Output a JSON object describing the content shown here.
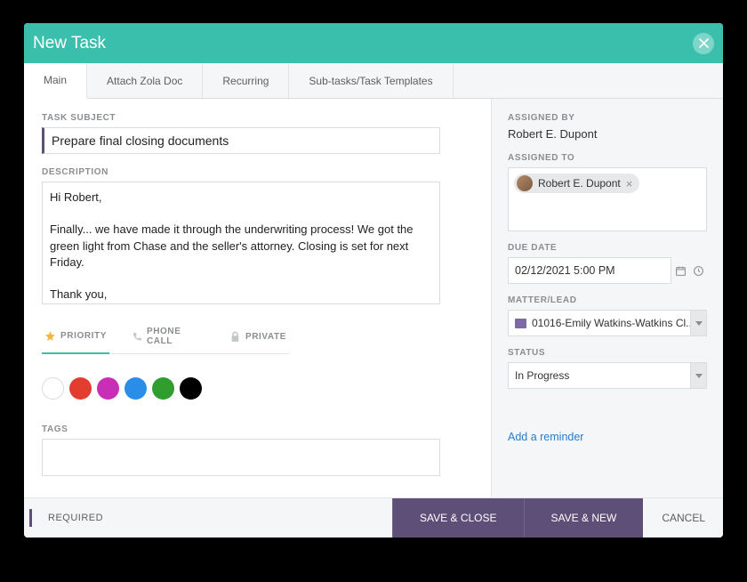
{
  "header": {
    "title": "New Task"
  },
  "tabs": [
    {
      "label": "Main",
      "active": true
    },
    {
      "label": "Attach Zola Doc",
      "active": false
    },
    {
      "label": "Recurring",
      "active": false
    },
    {
      "label": "Sub-tasks/Task Templates",
      "active": false
    }
  ],
  "left": {
    "subject_label": "TASK SUBJECT",
    "subject_value": "Prepare final closing documents",
    "description_label": "DESCRIPTION",
    "description_value": "Hi Robert,\n\nFinally... we have made it through the underwriting process! We got the green light from Chase and the seller's attorney. Closing is set for next Friday.\n\nThank you,\nSarah",
    "subtabs": {
      "priority": "PRIORITY",
      "phone": "PHONE CALL",
      "private": "PRIVATE"
    },
    "colors": [
      "#ffffff",
      "#e23d2e",
      "#c92fb6",
      "#2a8de8",
      "#2f9e2f",
      "#000000"
    ],
    "tags_label": "TAGS"
  },
  "right": {
    "assigned_by_label": "ASSIGNED BY",
    "assigned_by_value": "Robert E. Dupont",
    "assigned_to_label": "ASSIGNED TO",
    "assigned_to_chip": "Robert E. Dupont",
    "due_date_label": "DUE DATE",
    "due_date_value": "02/12/2021 5:00 PM",
    "matter_label": "MATTER/LEAD",
    "matter_value": "01016-Emily Watkins-Watkins Cl...",
    "status_label": "STATUS",
    "status_value": "In Progress",
    "reminder_link": "Add a reminder"
  },
  "footer": {
    "required": "REQUIRED",
    "save_close": "SAVE & CLOSE",
    "save_new": "SAVE & NEW",
    "cancel": "CANCEL"
  }
}
